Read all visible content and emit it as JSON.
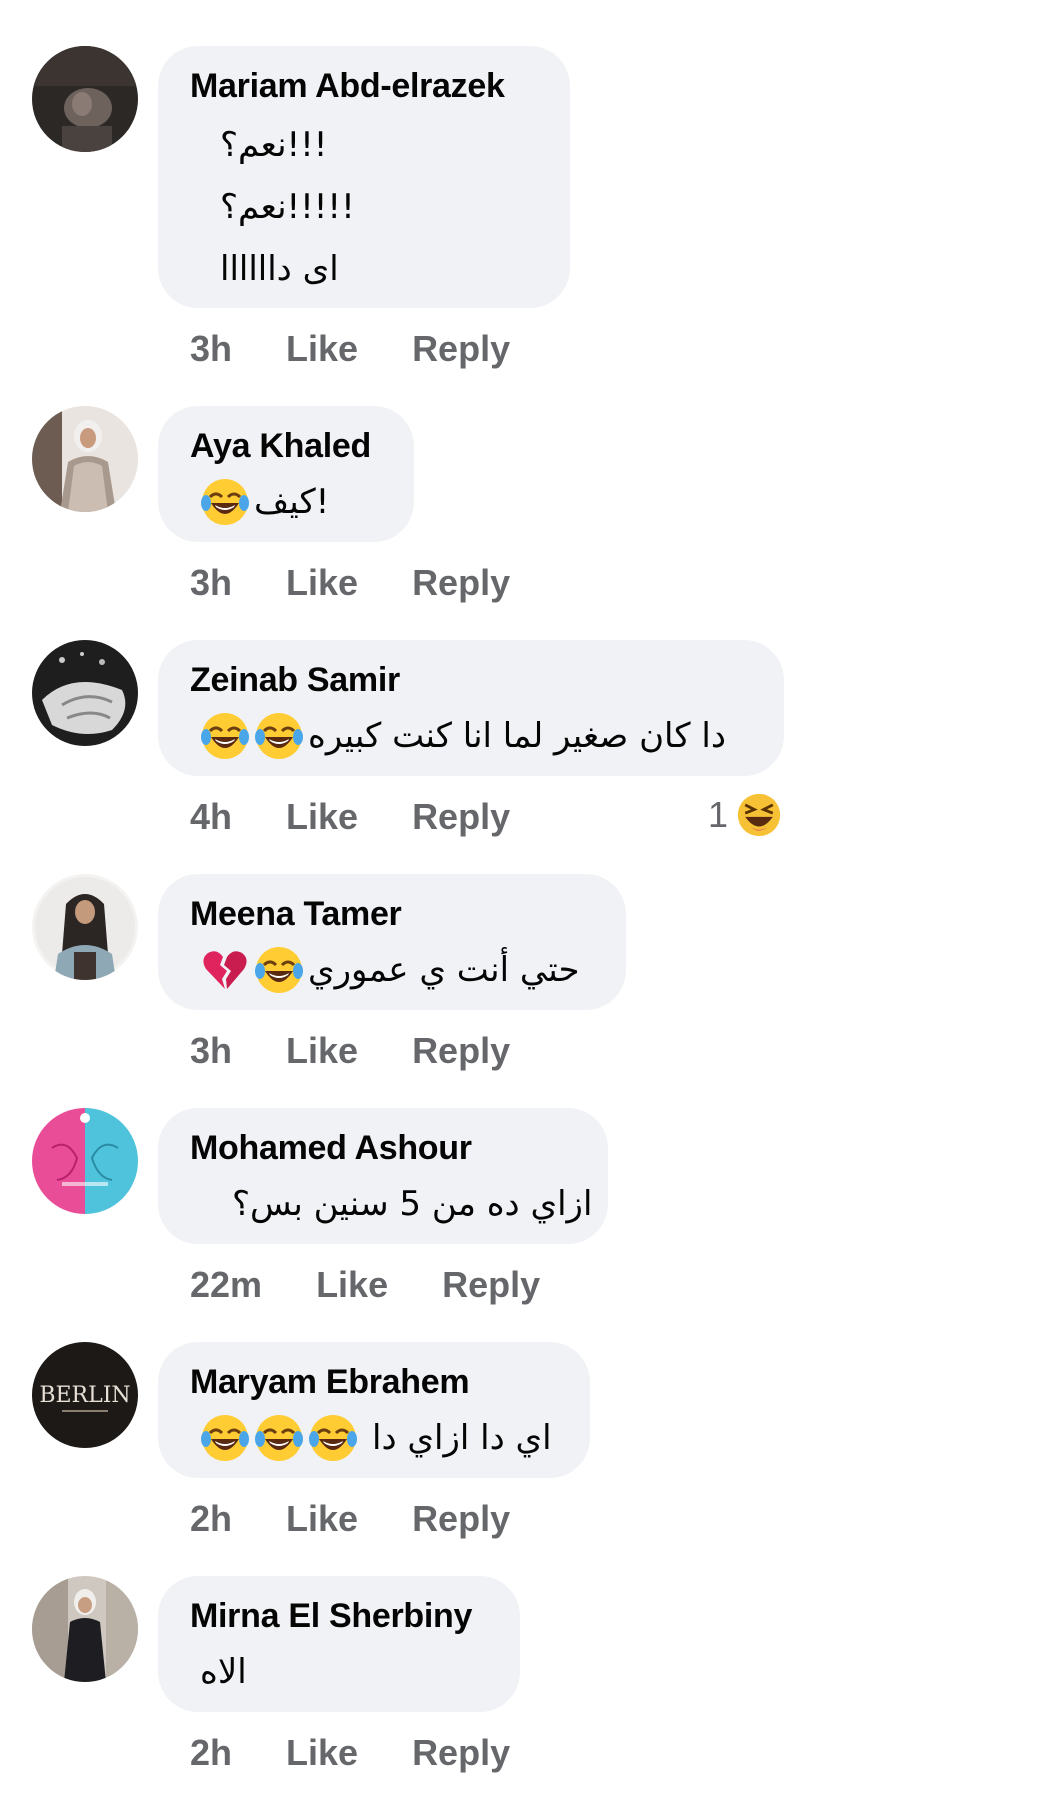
{
  "comments": [
    {
      "author": "Mariam Abd-elrazek",
      "lines": [
        "نعم؟!!!",
        "نعم؟!!!!!",
        "اى داااااا"
      ],
      "time": "3h",
      "like": "Like",
      "reply": "Reply"
    },
    {
      "author": "Aya Khaled",
      "text": "كيف!",
      "emojis": [
        "joy-emoji"
      ],
      "time": "3h",
      "like": "Like",
      "reply": "Reply"
    },
    {
      "author": "Zeinab Samir",
      "text": "دا كان صغير لما انا كنت كبيره",
      "emojis": [
        "joy-emoji",
        "joy-emoji"
      ],
      "time": "4h",
      "like": "Like",
      "reply": "Reply",
      "reaction_count": "1",
      "reaction_icon": "haha-reaction-icon"
    },
    {
      "author": "Meena Tamer",
      "text": "حتي أنت ي عموري",
      "emojis": [
        "broken-heart-emoji",
        "joy-emoji"
      ],
      "time": "3h",
      "like": "Like",
      "reply": "Reply"
    },
    {
      "author": "Mohamed Ashour",
      "text": "ازاي ده من 5 سنين بس؟",
      "time": "22m",
      "like": "Like",
      "reply": "Reply"
    },
    {
      "author": "Maryam Ebrahem",
      "text": "اي دا ازاي دا",
      "emojis": [
        "joy-emoji",
        "joy-emoji",
        "joy-emoji"
      ],
      "time": "2h",
      "like": "Like",
      "reply": "Reply",
      "avatar_text": "BERLIN"
    },
    {
      "author": "Mirna El Sherbiny",
      "text": "الاه",
      "time": "2h",
      "like": "Like",
      "reply": "Reply"
    }
  ],
  "colors": {
    "bubble": "#f0f2f5",
    "meta": "#65676b",
    "text": "#050505"
  }
}
